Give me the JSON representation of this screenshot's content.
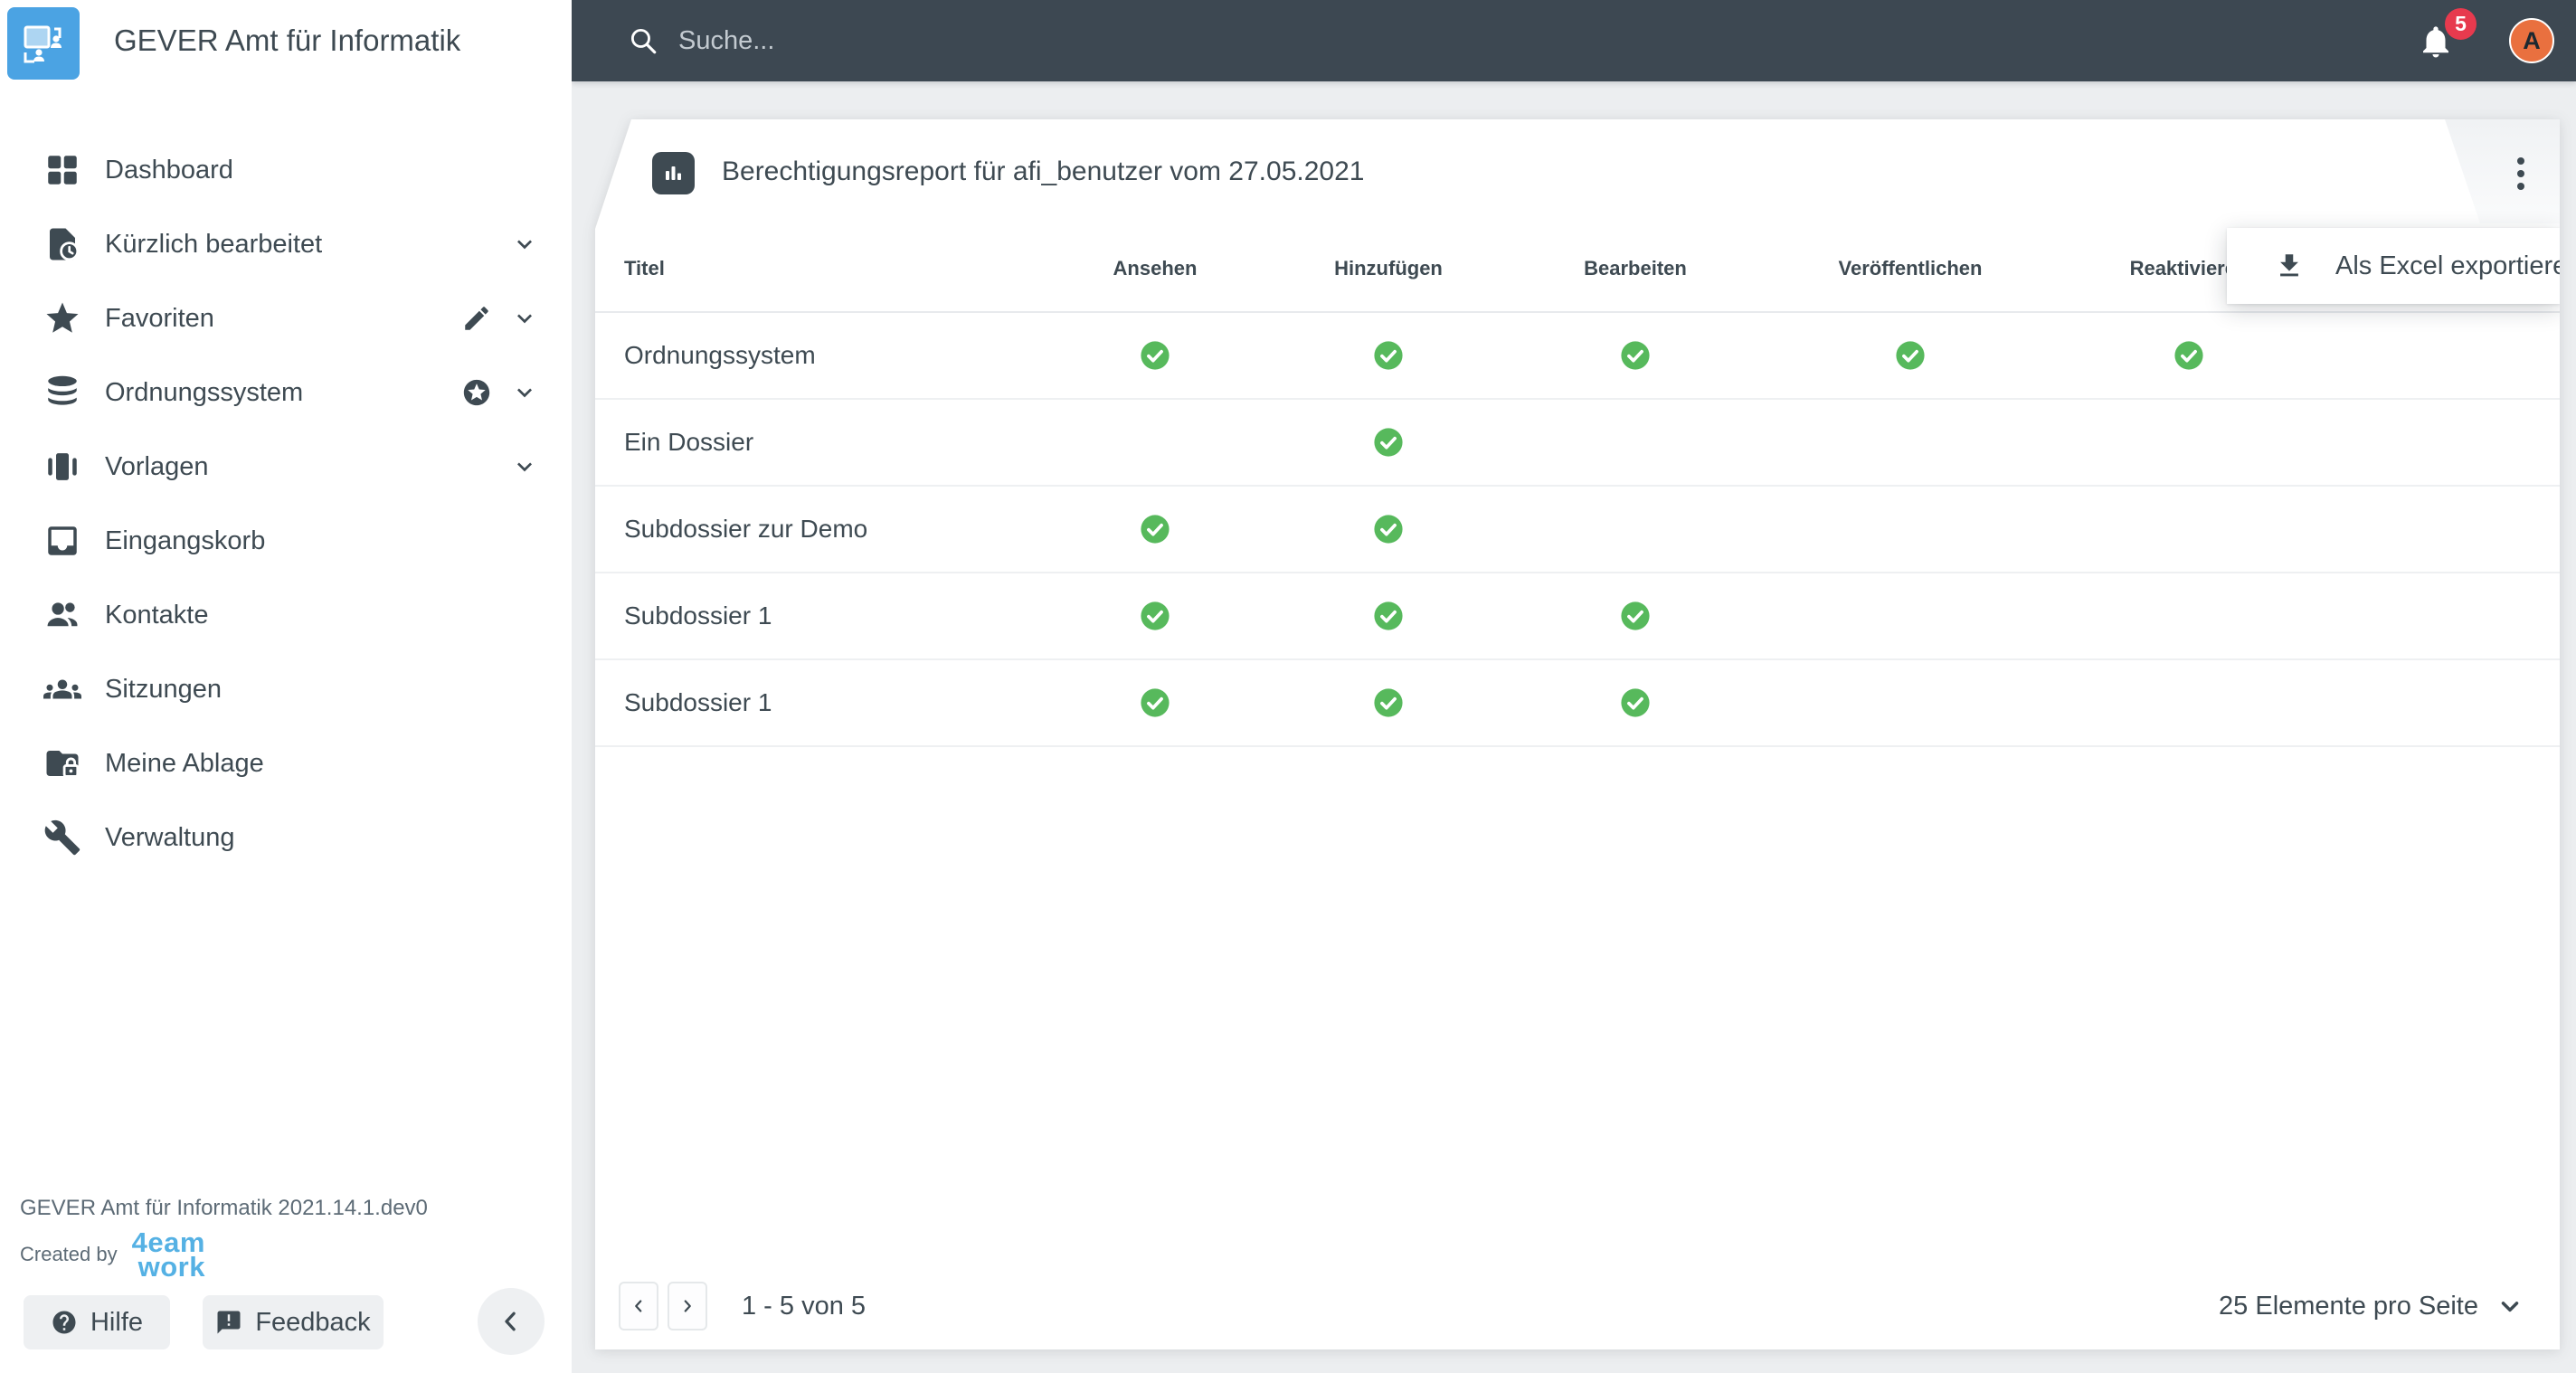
{
  "app": {
    "brand_title": "GEVER Amt für Informatik",
    "version_line": "GEVER Amt für Informatik 2021.14.1.dev0",
    "created_by_label": "Created by",
    "brand_logo_line1": "4eam",
    "brand_logo_line2": "work"
  },
  "topbar": {
    "search_placeholder": "Suche...",
    "notification_count": "5",
    "avatar_initial": "A"
  },
  "sidebar": {
    "items": [
      {
        "label": "Dashboard"
      },
      {
        "label": "Kürzlich bearbeitet"
      },
      {
        "label": "Favoriten"
      },
      {
        "label": "Ordnungssystem"
      },
      {
        "label": "Vorlagen"
      },
      {
        "label": "Eingangskorb"
      },
      {
        "label": "Kontakte"
      },
      {
        "label": "Sitzungen"
      },
      {
        "label": "Meine Ablage"
      },
      {
        "label": "Verwaltung"
      }
    ],
    "help_label": "Hilfe",
    "feedback_label": "Feedback"
  },
  "report": {
    "title": "Berechtigungsreport für afi_benutzer vom 27.05.2021",
    "export_menu_label": "Als Excel exportieren"
  },
  "table": {
    "columns": [
      "Titel",
      "Ansehen",
      "Hinzufügen",
      "Bearbeiten",
      "Veröffentlichen",
      "Reaktivieren"
    ],
    "rows": [
      {
        "title": "Ordnungssystem",
        "permissions": [
          true,
          true,
          true,
          true,
          true
        ]
      },
      {
        "title": "Ein Dossier",
        "permissions": [
          false,
          true,
          false,
          false,
          false
        ]
      },
      {
        "title": "Subdossier zur Demo",
        "permissions": [
          true,
          true,
          false,
          false,
          false
        ]
      },
      {
        "title": "Subdossier 1",
        "permissions": [
          true,
          true,
          true,
          false,
          false
        ]
      },
      {
        "title": "Subdossier 1",
        "permissions": [
          true,
          true,
          true,
          false,
          false
        ]
      }
    ]
  },
  "pagination": {
    "range_label": "1 - 5 von 5",
    "page_size_label": "25 Elemente pro Seite"
  },
  "colors": {
    "topbar_bg": "#3d4852",
    "logo_blue": "#4ba3e3",
    "brand_blue": "#55b1e4",
    "check_green": "#57b95c",
    "badge_red": "#e73a4e",
    "avatar_orange": "#e9703f"
  }
}
